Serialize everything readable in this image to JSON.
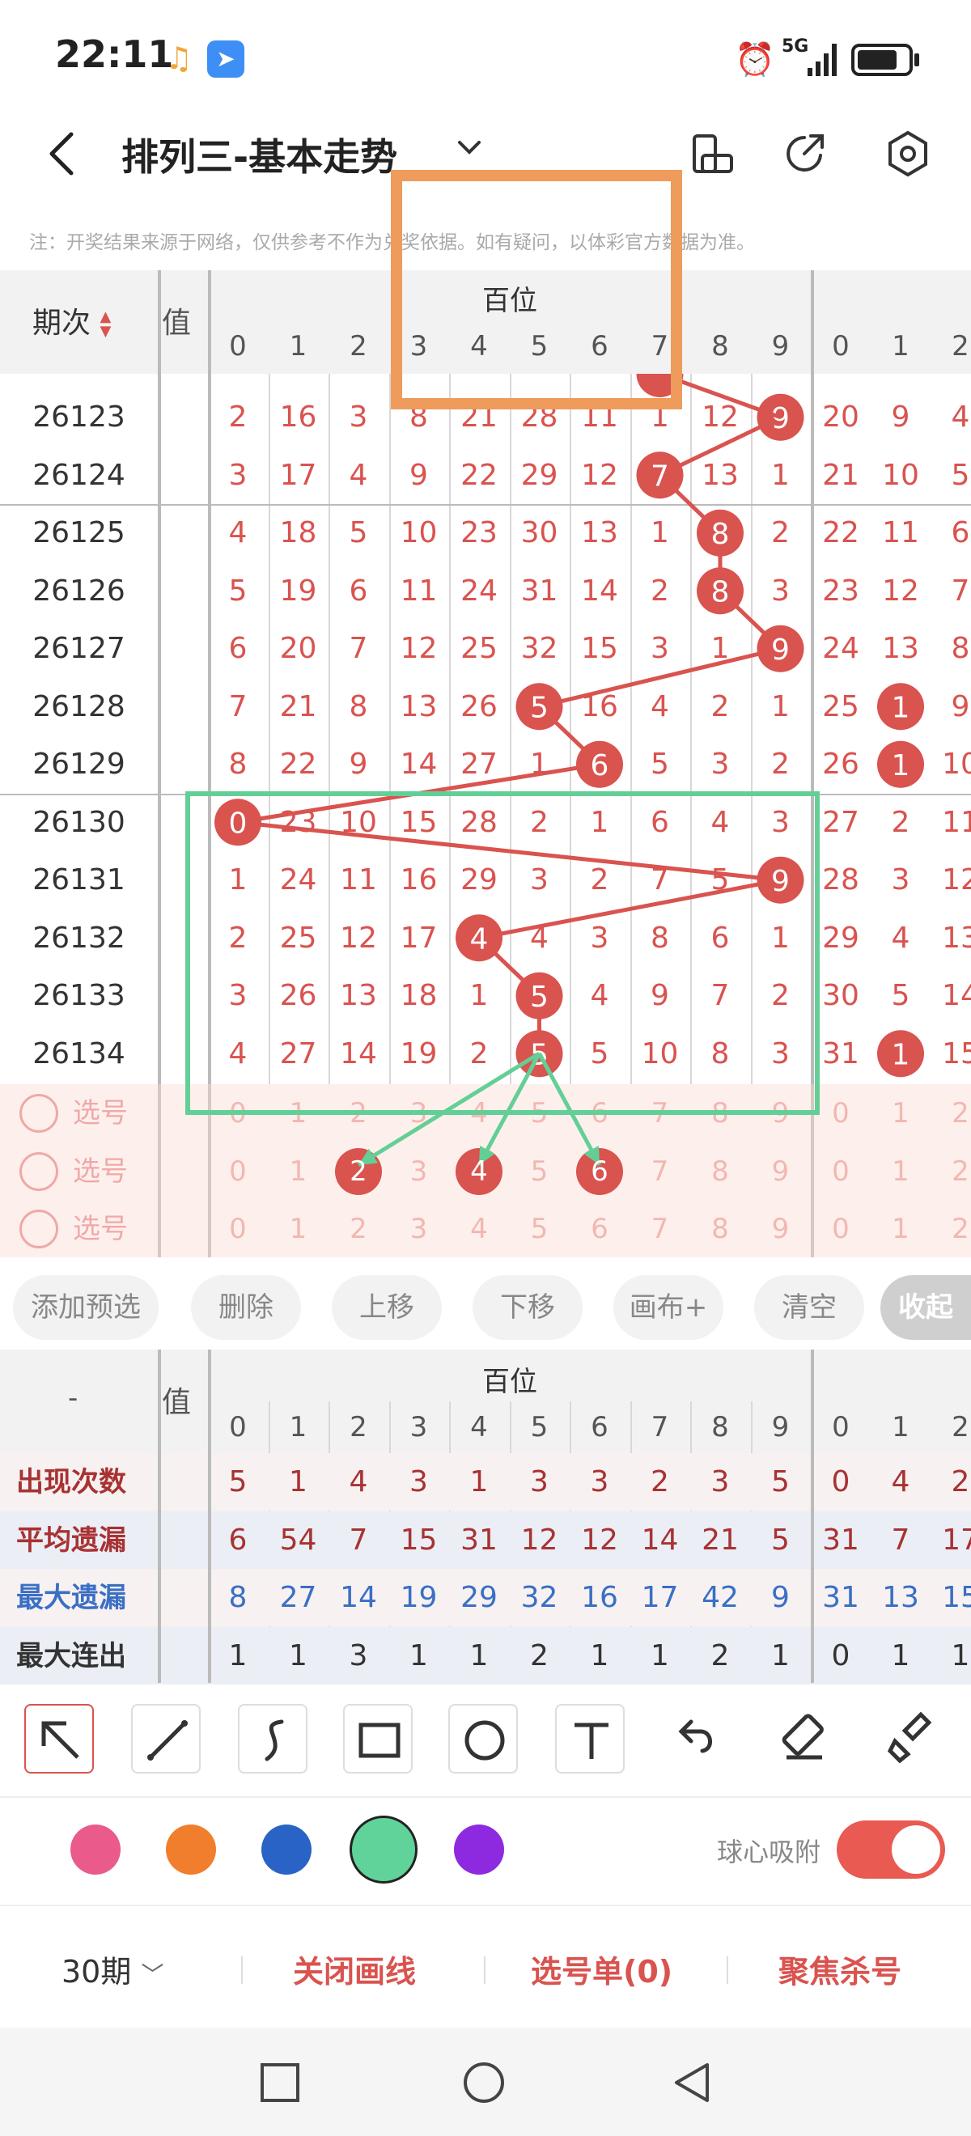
{
  "status": {
    "time": "22:11",
    "network": "5G",
    "battery_percent": 80
  },
  "header": {
    "title": "排列三-基本走势"
  },
  "notice": "注：开奖结果来源于网络，仅供参考不作为兑奖依据。如有疑问，以体彩官方数据为准。",
  "table": {
    "period_header": "期次",
    "section_title": "百位",
    "partial_col_label": "值",
    "digits": [
      "0",
      "1",
      "2",
      "3",
      "4",
      "5",
      "6",
      "7",
      "8",
      "9"
    ],
    "right_digits": [
      "0",
      "1",
      "2"
    ],
    "rows": [
      {
        "period": "26123",
        "cells": [
          "2",
          "16",
          "3",
          "8",
          "21",
          "28",
          "11",
          "1",
          "12",
          "9"
        ],
        "hit": 9,
        "right": [
          "20",
          "9",
          "4"
        ]
      },
      {
        "period": "26124",
        "cells": [
          "3",
          "17",
          "4",
          "9",
          "22",
          "29",
          "12",
          "7",
          "13",
          "1"
        ],
        "hit": 7,
        "right": [
          "21",
          "10",
          "5"
        ]
      },
      {
        "period": "26125",
        "cells": [
          "4",
          "18",
          "5",
          "10",
          "23",
          "30",
          "13",
          "1",
          "8",
          "2"
        ],
        "hit": 8,
        "right": [
          "22",
          "11",
          "6"
        ]
      },
      {
        "period": "26126",
        "cells": [
          "5",
          "19",
          "6",
          "11",
          "24",
          "31",
          "14",
          "2",
          "8",
          "3"
        ],
        "hit": 8,
        "right": [
          "23",
          "12",
          "7"
        ]
      },
      {
        "period": "26127",
        "cells": [
          "6",
          "20",
          "7",
          "12",
          "25",
          "32",
          "15",
          "3",
          "1",
          "9"
        ],
        "hit": 9,
        "right": [
          "24",
          "13",
          "8"
        ]
      },
      {
        "period": "26128",
        "cells": [
          "7",
          "21",
          "8",
          "13",
          "26",
          "5",
          "16",
          "4",
          "2",
          "1"
        ],
        "hit": 5,
        "right": [
          "25",
          "1",
          "9"
        ]
      },
      {
        "period": "26129",
        "cells": [
          "8",
          "22",
          "9",
          "14",
          "27",
          "1",
          "6",
          "5",
          "3",
          "2"
        ],
        "hit": 6,
        "right": [
          "26",
          "1",
          "10"
        ]
      },
      {
        "period": "26130",
        "cells": [
          "0",
          "23",
          "10",
          "15",
          "28",
          "2",
          "1",
          "6",
          "4",
          "3"
        ],
        "hit": 0,
        "right": [
          "27",
          "2",
          "11"
        ]
      },
      {
        "period": "26131",
        "cells": [
          "1",
          "24",
          "11",
          "16",
          "29",
          "3",
          "2",
          "7",
          "5",
          "9"
        ],
        "hit": 9,
        "right": [
          "28",
          "3",
          "12"
        ]
      },
      {
        "period": "26132",
        "cells": [
          "2",
          "25",
          "12",
          "17",
          "4",
          "4",
          "3",
          "8",
          "6",
          "1"
        ],
        "hit": 4,
        "right": [
          "29",
          "4",
          "13"
        ]
      },
      {
        "period": "26133",
        "cells": [
          "3",
          "26",
          "13",
          "18",
          "1",
          "5",
          "4",
          "9",
          "7",
          "2"
        ],
        "hit": 5,
        "right": [
          "30",
          "5",
          "14"
        ]
      },
      {
        "period": "26134",
        "cells": [
          "4",
          "27",
          "14",
          "19",
          "2",
          "5",
          "5",
          "10",
          "8",
          "3"
        ],
        "hit": 5,
        "right": [
          "31",
          "1",
          "15"
        ]
      }
    ],
    "select_label": "选号",
    "select_rows": [
      {
        "selected": []
      },
      {
        "selected": [
          2,
          4,
          6
        ]
      },
      {
        "selected": []
      }
    ]
  },
  "buttons": {
    "add_preselect": "添加预选",
    "delete": "删除",
    "move_up": "上移",
    "move_down": "下移",
    "canvas_plus": "画布+",
    "clear": "清空",
    "collapse": "收起"
  },
  "stats": {
    "dash": "-",
    "section_title": "百位",
    "partial_col_label": "值",
    "rows": [
      {
        "label": "出现次数",
        "color": "#a83232",
        "values": [
          "5",
          "1",
          "4",
          "3",
          "1",
          "3",
          "3",
          "2",
          "3",
          "5"
        ],
        "right": [
          "0",
          "4",
          "2"
        ]
      },
      {
        "label": "平均遗漏",
        "color": "#a83232",
        "values": [
          "6",
          "54",
          "7",
          "15",
          "31",
          "12",
          "12",
          "14",
          "21",
          "5"
        ],
        "right": [
          "31",
          "7",
          "17"
        ]
      },
      {
        "label": "最大遗漏",
        "color": "#3a6fc4",
        "values": [
          "8",
          "27",
          "14",
          "19",
          "29",
          "32",
          "16",
          "17",
          "42",
          "9"
        ],
        "right": [
          "31",
          "13",
          "15"
        ]
      },
      {
        "label": "最大连出",
        "color": "#333333",
        "values": [
          "1",
          "1",
          "3",
          "1",
          "1",
          "2",
          "1",
          "1",
          "2",
          "1"
        ],
        "right": [
          "0",
          "1",
          "1"
        ]
      }
    ]
  },
  "tools": [
    "arrow-tool",
    "line-tool",
    "curve-tool",
    "rectangle-tool",
    "circle-tool",
    "text-tool",
    "undo-tool",
    "eraser-tool",
    "brush-tool"
  ],
  "colors": [
    "#ea5a8a",
    "#f07e2c",
    "#2a63c6",
    "#5fd39a",
    "#8d2ae0"
  ],
  "selected_color": "#5fd39a",
  "snap_label": "球心吸附",
  "snap_on": true,
  "bottom_menu": {
    "periods": "30期",
    "close_draw": "关闭画线",
    "pick_list": "选号单(0)",
    "focus_kill": "聚焦杀号"
  }
}
